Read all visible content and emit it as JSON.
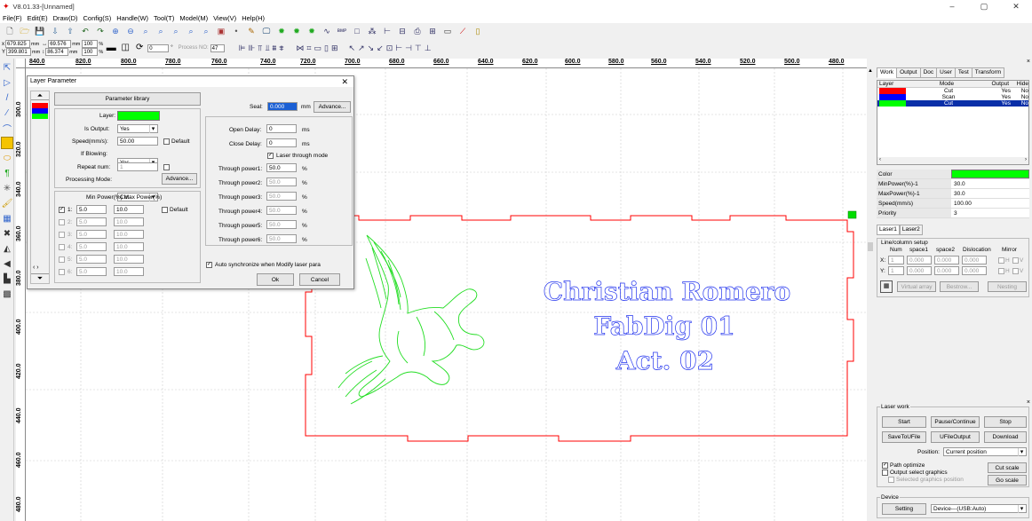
{
  "app": {
    "title": "V8.01.33-[Unnamed]",
    "menu": [
      "File(F)",
      "Edit(E)",
      "Draw(D)",
      "Config(S)",
      "Handle(W)",
      "Tool(T)",
      "Model(M)",
      "View(V)",
      "Help(H)"
    ],
    "window_buttons": [
      "–",
      "▢",
      "✕"
    ]
  },
  "coords": {
    "x_pos": "679.825",
    "y_pos": "399.801",
    "pos_unit": "mm",
    "width": "69.576",
    "height": "86.374",
    "size_unit": "mm",
    "scale_x": "100",
    "scale_y": "100",
    "scale_unit": "%",
    "rotate": "0",
    "rotate_unit": "°",
    "process_no_label": "Process NO:",
    "process_no": "47"
  },
  "ruler": {
    "h_ticks": [
      "840.0",
      "820.0",
      "800.0",
      "780.0",
      "760.0",
      "740.0",
      "720.0",
      "700.0",
      "680.0",
      "660.0",
      "640.0",
      "620.0",
      "600.0",
      "580.0",
      "560.0",
      "540.0",
      "520.0",
      "500.0",
      "480.0"
    ],
    "v_ticks": [
      "300.0",
      "320.0",
      "340.0",
      "360.0",
      "380.0",
      "400.0",
      "420.0",
      "440.0",
      "460.0",
      "480.0"
    ]
  },
  "canvas": {
    "text_lines": [
      "Christian Romero",
      "FabDig 01",
      "Act. 02"
    ],
    "colors": {
      "cut_red": "#ff0000",
      "scan_blue": "#0000ff",
      "cut_green": "#00ff00"
    }
  },
  "dialog": {
    "title": "Layer Parameter",
    "close": "✕",
    "param_library": "Parameter library",
    "layer_label": "Layer:",
    "layer_color": "#00ff00",
    "is_output_label": "Is Output:",
    "is_output": "Yes",
    "speed_label": "Speed(mm/s):",
    "speed": "50.00",
    "default_label": "Default",
    "if_blowing_label": "If Blowing:",
    "if_blowing": "Yes",
    "repeat_label": "Repeat num:",
    "repeat": "1",
    "mode_label": "Processing Mode:",
    "mode": "Cut",
    "advance": "Advance...",
    "power_header": "Min Power(%) Max Power(%)",
    "powers": [
      {
        "n": "1:",
        "min": "5.0",
        "max": "10.0",
        "enabled": true
      },
      {
        "n": "2:",
        "min": "5.0",
        "max": "10.0",
        "enabled": false
      },
      {
        "n": "3:",
        "min": "5.0",
        "max": "10.0",
        "enabled": false
      },
      {
        "n": "4:",
        "min": "5.0",
        "max": "10.0",
        "enabled": false
      },
      {
        "n": "5:",
        "min": "5.0",
        "max": "10.0",
        "enabled": false
      },
      {
        "n": "6:",
        "min": "5.0",
        "max": "10.0",
        "enabled": false
      }
    ],
    "power_default": "Default",
    "seal_label": "Seal:",
    "seal": "0.000",
    "seal_unit": "mm",
    "open_delay_label": "Open Delay:",
    "open_delay": "0",
    "ms": "ms",
    "close_delay_label": "Close Delay:",
    "close_delay": "0",
    "laser_through": "Laser through mode",
    "through_powers": [
      {
        "label": "Through power1:",
        "value": "50.0"
      },
      {
        "label": "Through power2:",
        "value": "50.0"
      },
      {
        "label": "Through power3:",
        "value": "50.0"
      },
      {
        "label": "Through power4:",
        "value": "50.0"
      },
      {
        "label": "Through power5:",
        "value": "50.0"
      },
      {
        "label": "Through power6:",
        "value": "50.0"
      }
    ],
    "pct": "%",
    "auto_sync": "Auto synchronize when Modify laser para",
    "ok": "Ok",
    "cancel": "Cancel"
  },
  "right": {
    "tabs": [
      "Work",
      "Output",
      "Doc",
      "User",
      "Test",
      "Transform"
    ],
    "layer_headers": [
      "Layer",
      "Mode",
      "Output",
      "Hide"
    ],
    "layers": [
      {
        "color": "#ff0000",
        "mode": "Cut",
        "output": "Yes",
        "hide": "No"
      },
      {
        "color": "#0000ff",
        "mode": "Scan",
        "output": "Yes",
        "hide": "No"
      },
      {
        "color": "#00ff00",
        "mode": "Cut",
        "output": "Yes",
        "hide": "No"
      }
    ],
    "props": [
      {
        "k": "Color",
        "v": ""
      },
      {
        "k": "MinPower(%)-1",
        "v": "30.0"
      },
      {
        "k": "MaxPower(%)-1",
        "v": "30.0"
      },
      {
        "k": "Speed(mm/s)",
        "v": "100.00"
      },
      {
        "k": "Priority",
        "v": "3"
      }
    ],
    "laser_tabs": [
      "Laser1",
      "Laser2"
    ],
    "line_col_title": "Line/column setup",
    "lc_headers": [
      "Num",
      "space1",
      "space2",
      "Dislocation",
      "Mirror"
    ],
    "lc_rows": [
      {
        "axis": "X:",
        "num": "1",
        "s1": "0.000",
        "s2": "0.000",
        "dis": "0.000",
        "m1": "H",
        "m2": "V"
      },
      {
        "axis": "Y:",
        "num": "1",
        "s1": "0.000",
        "s2": "0.000",
        "dis": "0.000",
        "m1": "H",
        "m2": "V"
      }
    ],
    "virtual_array": "Virtual array",
    "bestrow": "Bestrow...",
    "nesting": "Nesting",
    "laser_work": "Laser work",
    "start": "Start",
    "pause": "Pause/Continue",
    "stop": "Stop",
    "save_u": "SaveToUFile",
    "ufile_output": "UFileOutput",
    "download": "Download",
    "position_label": "Position:",
    "position": "Current position",
    "path_opt": "Path optimize",
    "output_select": "Output select graphics",
    "selected_pos": "Selected graphics position",
    "cut_scale": "Cut scale",
    "go_scale": "Go scale",
    "device_title": "Device",
    "setting": "Setting",
    "device": "Device---(USB:Auto)"
  }
}
